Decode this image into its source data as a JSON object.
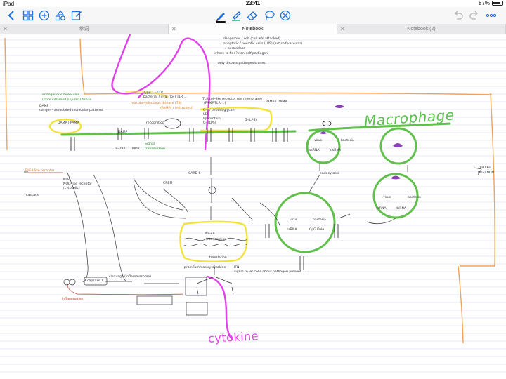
{
  "status_bar": {
    "carrier": "iPad",
    "wifi": "wifi",
    "time": "23:41",
    "battery_percent": "87%",
    "battery_level": 0.87
  },
  "toolbar": {
    "left": [
      {
        "name": "back-icon"
      },
      {
        "name": "grid-view-icon"
      },
      {
        "name": "add-icon"
      },
      {
        "name": "shapes-icon"
      },
      {
        "name": "edit-icon"
      }
    ],
    "center": [
      {
        "name": "pen-tool-icon",
        "active": true
      },
      {
        "name": "highlighter-tool-icon"
      },
      {
        "name": "eraser-tool-icon"
      },
      {
        "name": "lasso-tool-icon"
      },
      {
        "name": "remove-tool-icon"
      }
    ],
    "right": [
      {
        "name": "undo-icon"
      },
      {
        "name": "redo-icon"
      },
      {
        "name": "more-icon"
      }
    ],
    "accent_color": "#1a6fe0"
  },
  "tabs": [
    {
      "label": "拳词",
      "active": false
    },
    {
      "label": "Notebook",
      "active": true
    },
    {
      "label": "Notebook (2)",
      "active": false
    }
  ],
  "notes": {
    "top_list": [
      "dangerous / self (cell w/o attacked)",
      "apoptotic / necrotic cells (LPS) (act self-vascular)",
      "... peroxidase",
      "where to find? non-self pathogen",
      "only discuss pathogenic ones"
    ],
    "endogenous": "endogenous molecules",
    "from_inflamed": "(from inflamed (injured) tissue",
    "damp_def": "DAMP",
    "damp_full": "danger - associated molecular patterns",
    "type1_tlr": "Type 1 - TLR",
    "type1_sub": "bacterial / viral (lps) TLR ...",
    "infectious": "microbe-infectious disease (TB)",
    "pamps": "(PAMPs / (microbes))",
    "tlr_title": "TLR  toll-like receptor (on membrane)",
    "tlr_sub": "(PAMP-TLR ...)",
    "tlr_box": [
      "G+ / peptidoglycan",
      "LTA",
      "lipoprotein",
      "G- (LPS)"
    ],
    "pamp_damp_right": "PAMP / DAMP",
    "g_lps": "G-(LPS)",
    "damp_pamp_left": "DAMP / PAMP",
    "recognition": "recognition",
    "signal": "Signal",
    "transduction": "transduction",
    "damp_mid": "DAMP",
    "ie_dap": "IE-DAP",
    "mdp": "MDP",
    "nlr": "NLR",
    "nod_like": "NOD-like receptor",
    "cytosolic": "(cytosolic)",
    "rig_i": "RIG-I-like receptor",
    "cascade": "cascade",
    "card6": "CARD 6",
    "crbm": "CRBM",
    "nfkb": "NF-κB",
    "transcription": "transcription",
    "translation": "translation",
    "cytokine_proinf": "proinflammatory cytokine",
    "ifn": "IFN",
    "signal_to_cell": "signal to let cells about pathogen present",
    "capsase": "capsase 1",
    "cleavage": "cleavage (inflammasome)",
    "inflammation": "inflammation",
    "macrophage_label": "Macrophage",
    "cytokine_label": "cytokine",
    "endocytosis": "endocytosis",
    "virus": "virus",
    "bacteria": "bacteria",
    "ss_rna": "ssRNA",
    "ds_rna": "dsRNA",
    "cpg_dna": "CpG DNA",
    "right_margin": [
      "TLR like",
      "RIG / NOD"
    ]
  }
}
